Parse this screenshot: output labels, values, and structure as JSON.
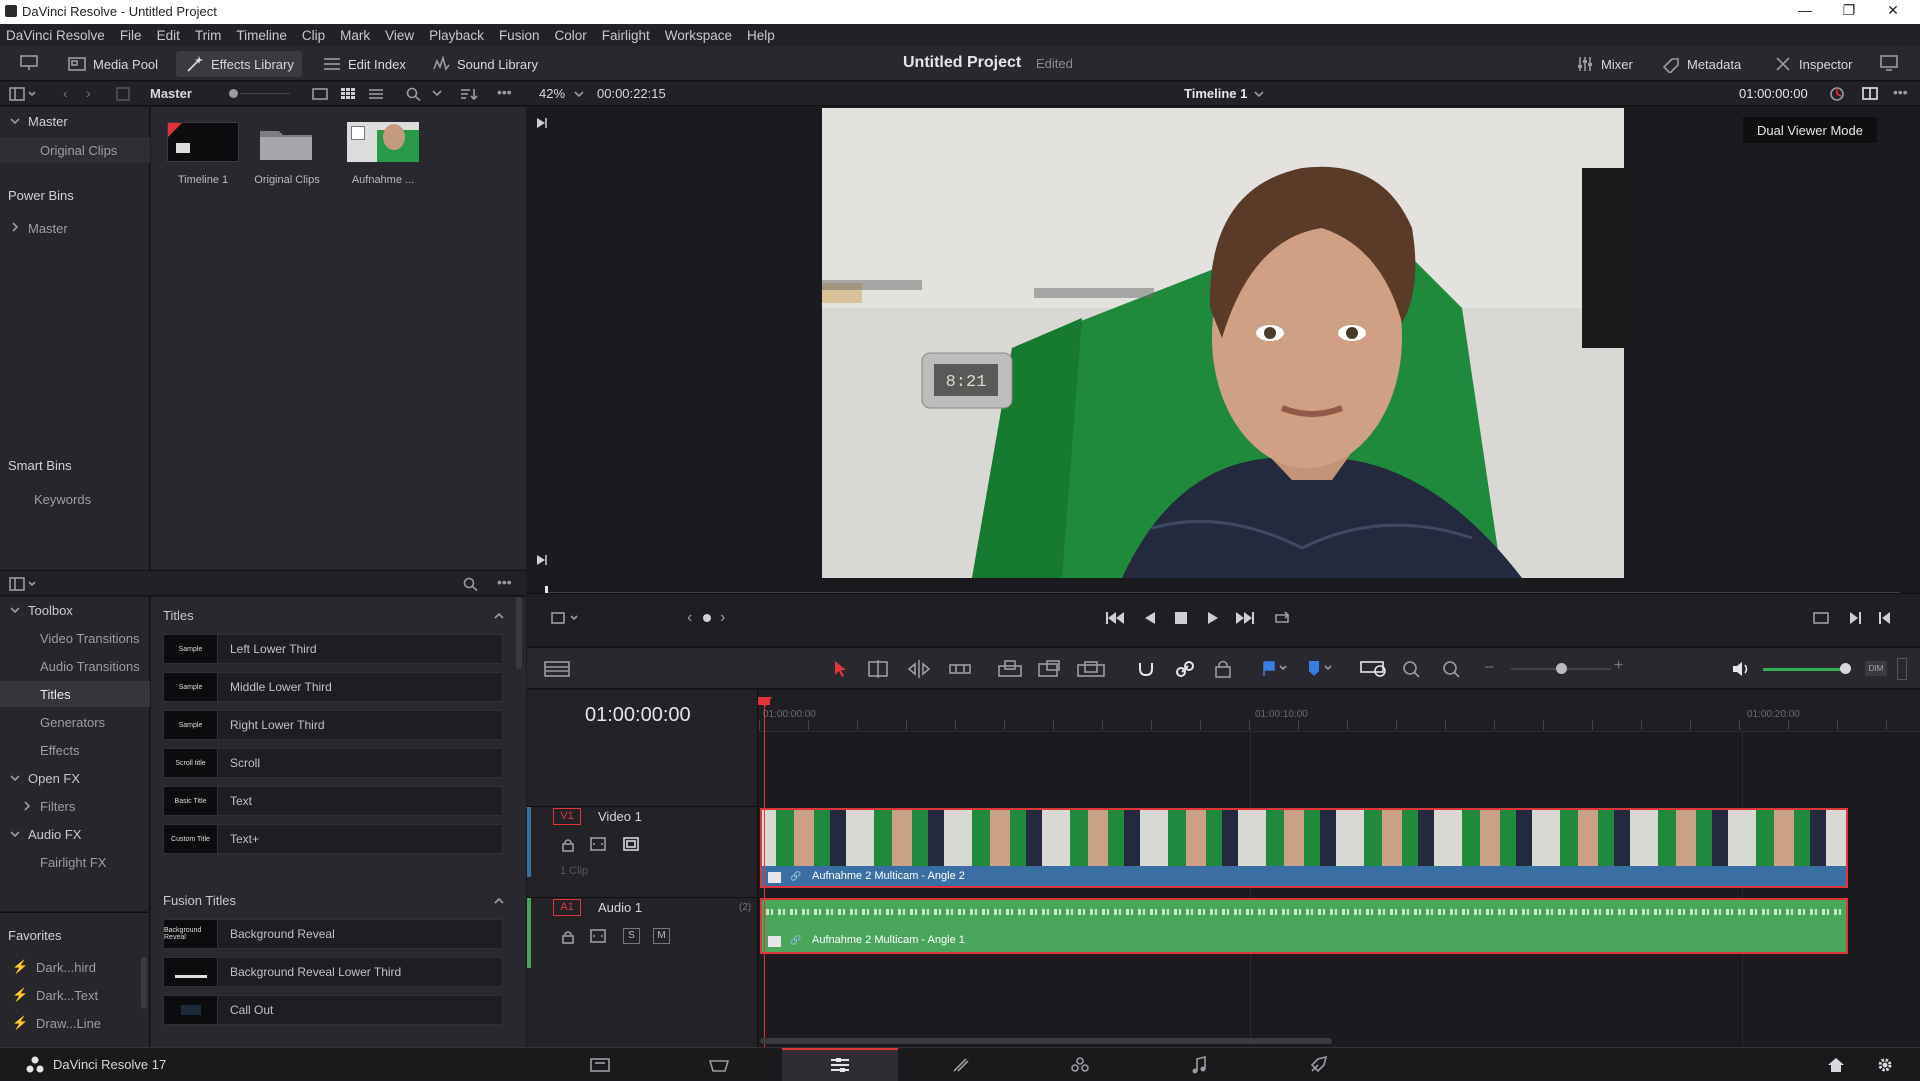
{
  "window": {
    "title": "DaVinci Resolve - Untitled Project"
  },
  "menu": [
    "DaVinci Resolve",
    "File",
    "Edit",
    "Trim",
    "Timeline",
    "Clip",
    "Mark",
    "View",
    "Playback",
    "Fusion",
    "Color",
    "Fairlight",
    "Workspace",
    "Help"
  ],
  "toolbar": {
    "media_pool": "Media Pool",
    "effects_library": "Effects Library",
    "edit_index": "Edit Index",
    "sound_library": "Sound Library",
    "project_title": "Untitled Project",
    "project_status": "Edited",
    "mixer": "Mixer",
    "metadata": "Metadata",
    "inspector": "Inspector"
  },
  "subbar": {
    "bin_name": "Master",
    "zoom": "42%",
    "duration": "00:00:22:15",
    "timeline_name": "Timeline 1",
    "timecode": "01:00:00:00"
  },
  "tooltip": "Dual Viewer Mode",
  "bins": {
    "master": "Master",
    "original_clips": "Original Clips",
    "power_bins": "Power Bins",
    "power_master": "Master",
    "smart_bins": "Smart Bins",
    "keywords": "Keywords"
  },
  "media": [
    {
      "label": "Timeline 1"
    },
    {
      "label": "Original Clips"
    },
    {
      "label": "Aufnahme ..."
    }
  ],
  "toolbox": {
    "toolbox": "Toolbox",
    "video_transitions": "Video Transitions",
    "audio_transitions": "Audio Transitions",
    "titles": "Titles",
    "generators": "Generators",
    "effects": "Effects",
    "open_fx": "Open FX",
    "filters": "Filters",
    "audio_fx": "Audio FX",
    "fairlight_fx": "Fairlight FX"
  },
  "favorites": {
    "header": "Favorites",
    "items": [
      "Dark...hird",
      "Dark...Text",
      "Draw...Line"
    ]
  },
  "titles_section": {
    "header": "Titles",
    "items": [
      {
        "label": "Left Lower Third",
        "thumb": "Sample"
      },
      {
        "label": "Middle Lower Third",
        "thumb": "Sample"
      },
      {
        "label": "Right Lower Third",
        "thumb": "Sample"
      },
      {
        "label": "Scroll",
        "thumb": "Scroll title"
      },
      {
        "label": "Text",
        "thumb": "Basic Title"
      },
      {
        "label": "Text+",
        "thumb": "Custom Title"
      }
    ]
  },
  "fusion_section": {
    "header": "Fusion Titles",
    "items": [
      {
        "label": "Background Reveal",
        "thumb": "Background Reveal"
      },
      {
        "label": "Background Reveal Lower Third",
        "thumb": ""
      },
      {
        "label": "Call Out",
        "thumb": ""
      }
    ]
  },
  "timeline": {
    "timecode": "01:00:00:00",
    "ruler": [
      "01:00:00:00",
      "01:00:10:00",
      "01:00:20:00"
    ],
    "video_track": {
      "id": "V1",
      "name": "Video 1",
      "count": "1 Clip",
      "clip": "Aufnahme 2 Multicam - Angle 2"
    },
    "audio_track": {
      "id": "A1",
      "name": "Audio 1",
      "channels": "(2)",
      "solo": "S",
      "mute": "M",
      "clip": "Aufnahme 2 Multicam - Angle 1"
    }
  },
  "clock_reading": "8:21",
  "app_name": "DaVinci Resolve 17",
  "colors": {
    "accent_red": "#e0353b",
    "video_clip": "#3a6fa3",
    "audio_clip": "#48a75a"
  }
}
